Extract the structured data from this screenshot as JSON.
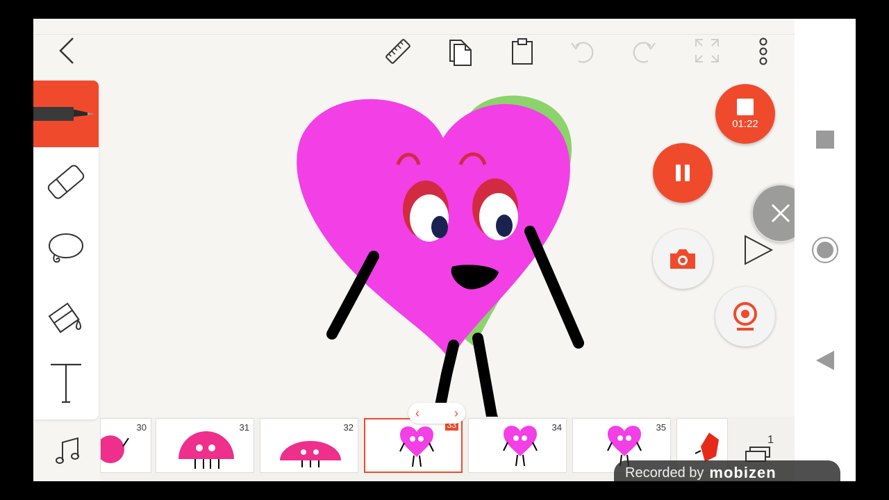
{
  "toolbar": {
    "back": "back",
    "ruler": "ruler",
    "copy": "copy",
    "paste": "paste",
    "undo": "undo",
    "redo": "redo",
    "fullscreen": "fullscreen",
    "more": "more"
  },
  "tools": [
    "pen",
    "eraser",
    "lasso",
    "fill",
    "text"
  ],
  "recorder": {
    "timer": "01:22",
    "watermark_text": "Recorded by",
    "watermark_logo": "mobizen"
  },
  "timeline": {
    "frames": [
      {
        "number": "30"
      },
      {
        "number": "31"
      },
      {
        "number": "32"
      },
      {
        "number": "33",
        "current": true
      },
      {
        "number": "34"
      },
      {
        "number": "35"
      }
    ],
    "layers_count": "1"
  },
  "colors": {
    "accent": "#f04a2c",
    "heart": "#f23fe6"
  }
}
